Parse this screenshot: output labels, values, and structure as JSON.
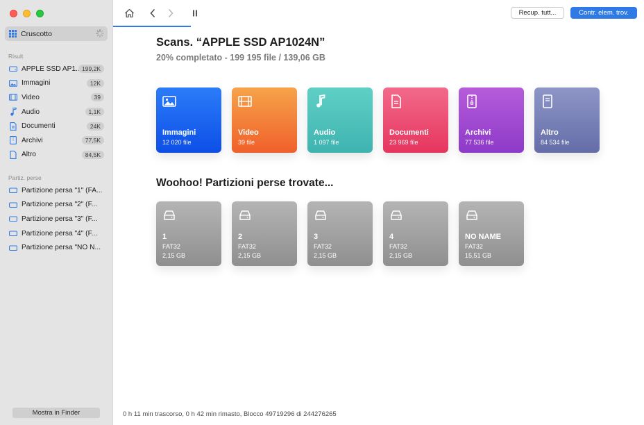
{
  "sidebar": {
    "dashboard_label": "Cruscotto",
    "results_title": "Risult.",
    "results": [
      {
        "icon": "drive-icon",
        "label": "APPLE SSD AP1...",
        "badge": "199,2K"
      },
      {
        "icon": "image-icon",
        "label": "Immagini",
        "badge": "12K"
      },
      {
        "icon": "video-icon",
        "label": "Video",
        "badge": "39"
      },
      {
        "icon": "music-icon",
        "label": "Audio",
        "badge": "1,1K"
      },
      {
        "icon": "document-icon",
        "label": "Documenti",
        "badge": "24K"
      },
      {
        "icon": "archive-icon",
        "label": "Archivi",
        "badge": "77,5K"
      },
      {
        "icon": "other-file-icon",
        "label": "Altro",
        "badge": "84,5K"
      }
    ],
    "lost_title": "Partiz. perse",
    "lost": [
      {
        "label": "Partizione persa \"1\" (FA..."
      },
      {
        "label": "Partizione persa \"2\" (F..."
      },
      {
        "label": "Partizione persa \"3\" (F..."
      },
      {
        "label": "Partizione persa \"4\" (F..."
      },
      {
        "label": "Partizione persa \"NO N..."
      }
    ],
    "finder_button": "Mostra in Finder"
  },
  "toolbar": {
    "recover_label": "Recup. tutt...",
    "review_label": "Contr. elem. trov."
  },
  "main": {
    "title": "Scans. “APPLE SSD AP1024N”",
    "subtitle": "20% completato - 199 195 file / 139,06 GB",
    "categories": [
      {
        "name": "Immagini",
        "count": "12 020 file",
        "icon": "image-icon",
        "class": "t-images"
      },
      {
        "name": "Video",
        "count": "39 file",
        "icon": "film-icon",
        "class": "t-video"
      },
      {
        "name": "Audio",
        "count": "1 097 file",
        "icon": "music-note-icon",
        "class": "t-audio"
      },
      {
        "name": "Documenti",
        "count": "23 969 file",
        "icon": "document-icon",
        "class": "t-docs"
      },
      {
        "name": "Archivi",
        "count": "77 536 file",
        "icon": "zip-archive-icon",
        "class": "t-arch"
      },
      {
        "name": "Altro",
        "count": "84 534 file",
        "icon": "other-file-icon",
        "class": "t-other"
      }
    ],
    "partitions_title": "Woohoo! Partizioni perse trovate...",
    "partitions": [
      {
        "name": "1",
        "fs": "FAT32",
        "size": "2,15 GB"
      },
      {
        "name": "2",
        "fs": "FAT32",
        "size": "2,15 GB"
      },
      {
        "name": "3",
        "fs": "FAT32",
        "size": "2,15 GB"
      },
      {
        "name": "4",
        "fs": "FAT32",
        "size": "2,15 GB"
      },
      {
        "name": "NO NAME",
        "fs": "FAT32",
        "size": "15,51 GB"
      }
    ]
  },
  "status": "0 h 11 min trascorso, 0 h 42 min rimasto, Blocco 49719296 di 244276265",
  "colors": {
    "accent": "#2f7ae5"
  }
}
